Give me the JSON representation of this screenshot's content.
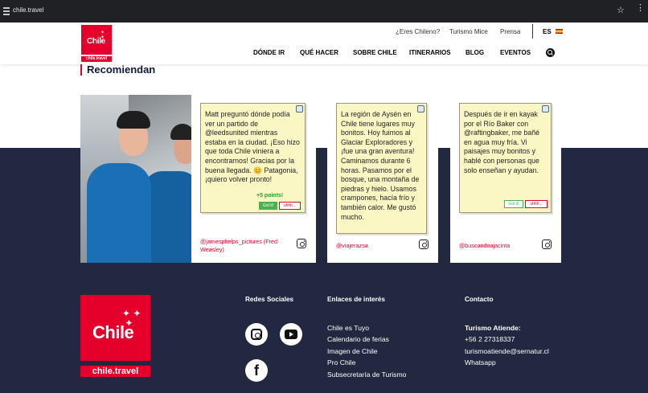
{
  "browser": {
    "url": "chile.travel",
    "star_icon": "☆",
    "menu_icon": "⋮"
  },
  "header": {
    "logo_word": "Chile",
    "logo_tag": "chile.travel",
    "utility": [
      "¿Eres Chileno?",
      "Turismo Mice",
      "Prensa"
    ],
    "language": "ES",
    "nav": [
      "DÓNDE IR",
      "QUÉ HACER",
      "SOBRE CHILE",
      "ITINERARIOS",
      "BLOG",
      "EVENTOS"
    ]
  },
  "recommend": {
    "title": "Recomiendan",
    "cards": [
      {
        "text": "Matt preguntó dónde podía ver un partido de @leedsunited mientras estaba en la ciudad. ¡Eso hizo que toda Chile viniera a encontrarnos! Gracias por la buena llegada. 😊 Patagonia, ¡quiero volver pronto!",
        "points": "+5 points!",
        "got": "Got it!",
        "uhh": "uhhh...",
        "handle": "@jamesphelps_pictures (Fred Weasley)"
      },
      {
        "text": "La región de Aysén en Chile tiene lugares muy bonitos. Hoy fuimos al Glaciar Exploradores y ¡fue una gran aventura! Caminamos durante 6 horas. Pasamos por el bosque, una montaña de piedras y hielo. Usamos crampones, hacía frío y también calor. Me gustó mucho.",
        "handle": "@viajerazsa"
      },
      {
        "text": "Después de ir en kayak por el Río Baker con @raftingbaker, me bañé en agua muy fría. Vi paisajes muy bonitos y hablé con personas que solo enseñan y ayudan.",
        "got": "Got it!",
        "uhh": "uhhh...",
        "handle": "@buscandoajacinta"
      }
    ]
  },
  "footer": {
    "logo_word": "Chile",
    "logo_tag": "chile.travel",
    "social_title": "Redes Sociales",
    "links_title": "Enlaces de interés",
    "links": [
      "Chile es Tuyo",
      "Calendario de ferias",
      "Imagen de Chile",
      "Pro Chile",
      "Subsecretaría de Turismo"
    ],
    "contact_title": "Contacto",
    "contact": {
      "heading": "Turismo Atiende:",
      "phone": "+56 2 27318337",
      "email": "turismoatiende@sernatur.cl",
      "whatsapp": "Whatsapp"
    }
  },
  "colors": {
    "brand_red": "#e4002b",
    "navy": "#212840",
    "note_yellow": "#fbf7c4"
  }
}
